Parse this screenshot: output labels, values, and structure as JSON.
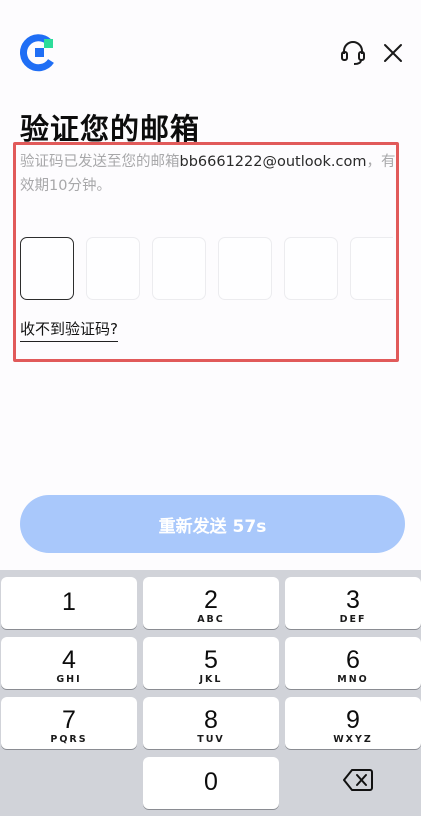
{
  "header": {
    "title": "验证您的邮箱",
    "description_prefix": "验证码已发送至您的邮箱",
    "email": "bb6661222@outlook.com",
    "description_suffix": "，有效期10分钟。"
  },
  "verification": {
    "box_count": 6,
    "resend_link": "收不到验证码?"
  },
  "resend_button": {
    "label": "重新发送 57s"
  },
  "colors": {
    "brand": "#1f6ef5",
    "brand_accent": "#2ddc9a",
    "button": "#a9c8fb",
    "highlight_border": "#e15a5a"
  },
  "keyboard": {
    "keys": [
      {
        "num": "1",
        "letters": ""
      },
      {
        "num": "2",
        "letters": "ABC"
      },
      {
        "num": "3",
        "letters": "DEF"
      },
      {
        "num": "4",
        "letters": "GHI"
      },
      {
        "num": "5",
        "letters": "JKL"
      },
      {
        "num": "6",
        "letters": "MNO"
      },
      {
        "num": "7",
        "letters": "PQRS"
      },
      {
        "num": "8",
        "letters": "TUV"
      },
      {
        "num": "9",
        "letters": "WXYZ"
      },
      {
        "num": "0",
        "letters": ""
      }
    ]
  }
}
